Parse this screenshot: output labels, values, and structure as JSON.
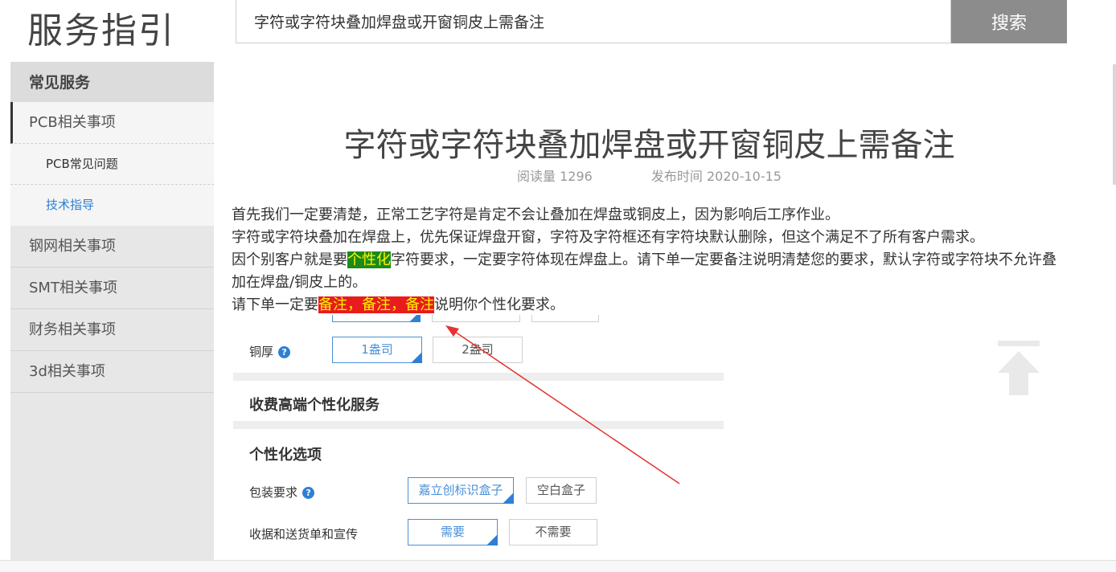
{
  "header": {
    "site_title": "服务指引",
    "search_value": "字符或字符块叠加焊盘或开窗铜皮上需备注",
    "search_button": "搜索"
  },
  "sidebar": {
    "heading": "常见服务",
    "items": [
      {
        "label": "PCB相关事项",
        "active": true
      },
      {
        "label": "PCB常见问题",
        "sub": true
      },
      {
        "label": "技术指导",
        "sub": true,
        "current": true
      },
      {
        "label": "钢网相关事项"
      },
      {
        "label": "SMT相关事项"
      },
      {
        "label": "财务相关事项"
      },
      {
        "label": "3d相关事项"
      }
    ]
  },
  "article": {
    "title": "字符或字符块叠加焊盘或开窗铜皮上需备注",
    "read_count": "阅读量 1296",
    "publish_time": "发布时间 2020-10-15",
    "para1": "首先我们一定要清楚，正常工艺字符是肯定不会让叠加在焊盘或铜皮上，因为影响后工序作业。",
    "para2": "字符或字符块叠加在焊盘上，优先保证焊盘开窗，字符及字符框还有字符块默认删除，但这个满足不了所有客户需求。",
    "para3_pre": "因个别客户就是要",
    "para3_hl": "个性化",
    "para3_post": "字符要求，一定要字符体现在焊盘上。请下单一定要备注说明清楚您的要求，默认字符或字符块不允许叠加在焊盘/铜皮上的。",
    "para4_pre": "请下单一定要",
    "para4_hl": "备注，备注，备注",
    "para4_post": "说明你个性化要求。"
  },
  "embedded_image": {
    "copper_label": "铜厚",
    "copper_opt1": "1盎司",
    "copper_opt2": "2盎司",
    "section1": "收费高端个性化服务",
    "section2": "个性化选项",
    "pack_label": "包装要求",
    "pack_opt1": "嘉立创标识盒子",
    "pack_opt2": "空白盒子",
    "receipt_label": "收据和送货单和宣传",
    "receipt_opt1": "需要",
    "receipt_opt2": "不需要",
    "help_glyph": "?"
  },
  "colors": {
    "highlight_green": "#1a8a1a",
    "highlight_red": "#e81c1c",
    "highlight_text": "#fff200",
    "link_blue": "#2a7fd4",
    "annotation_arrow": "#e53333"
  }
}
